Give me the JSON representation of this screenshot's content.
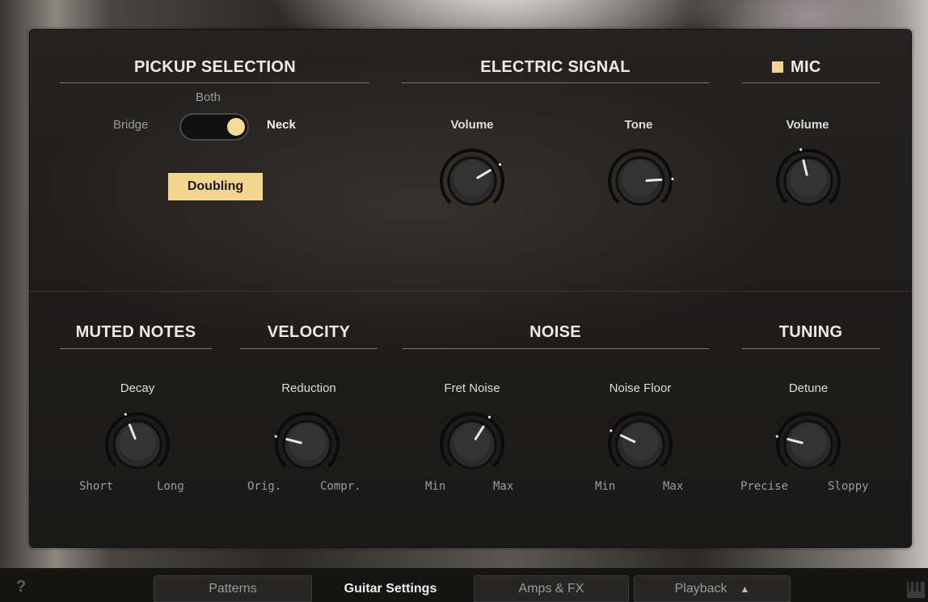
{
  "pickup": {
    "title": "PICKUP SELECTION",
    "both": "Both",
    "bridge": "Bridge",
    "neck": "Neck",
    "doubling": "Doubling",
    "toggle_state": "neck"
  },
  "electric": {
    "title": "ELECTRIC SIGNAL",
    "volume": {
      "label": "Volume",
      "value": 0.72
    },
    "tone": {
      "label": "Tone",
      "value": 0.82
    }
  },
  "mic": {
    "title": "MIC",
    "enabled": true,
    "volume": {
      "label": "Volume",
      "value": 0.45
    }
  },
  "muted": {
    "title": "MUTED NOTES",
    "decay": {
      "label": "Decay",
      "value": 0.42,
      "min": "Short",
      "max": "Long"
    }
  },
  "velocity": {
    "title": "VELOCITY",
    "reduction": {
      "label": "Reduction",
      "value": 0.22,
      "min": "Orig.",
      "max": "Compr."
    }
  },
  "noise": {
    "title": "NOISE",
    "fret": {
      "label": "Fret Noise",
      "value": 0.62,
      "min": "Min",
      "max": "Max"
    },
    "floor": {
      "label": "Noise Floor",
      "value": 0.26,
      "min": "Min",
      "max": "Max"
    }
  },
  "tuning": {
    "title": "TUNING",
    "detune": {
      "label": "Detune",
      "value": 0.22,
      "min": "Precise",
      "max": "Sloppy"
    }
  },
  "tabs": {
    "help": "?",
    "patterns": "Patterns",
    "guitar_settings": "Guitar Settings",
    "amps_fx": "Amps & FX",
    "playback": "Playback",
    "active": "Guitar Settings"
  },
  "colors": {
    "accent": "#f2d690",
    "panel": "#1f1e1d",
    "text": "#ecebea"
  }
}
